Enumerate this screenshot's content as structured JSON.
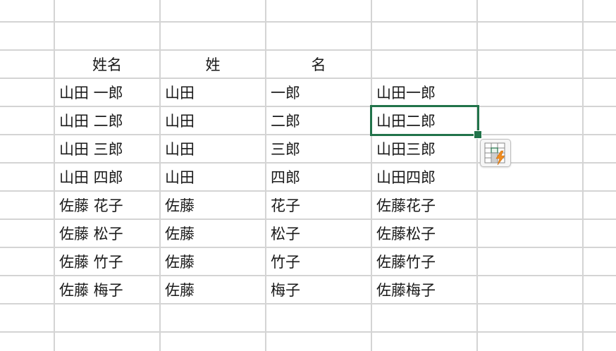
{
  "table": {
    "header": [
      "姓名",
      "姓",
      "名",
      ""
    ],
    "rows": [
      [
        "山田 一郎",
        "山田",
        "一郎",
        "山田一郎"
      ],
      [
        "山田 二郎",
        "山田",
        "二郎",
        "山田二郎"
      ],
      [
        "山田 三郎",
        "山田",
        "三郎",
        "山田三郎"
      ],
      [
        "山田 四郎",
        "山田",
        "四郎",
        "山田四郎"
      ],
      [
        "佐藤 花子",
        "佐藤",
        "花子",
        "佐藤花子"
      ],
      [
        "佐藤 松子",
        "佐藤",
        "松子",
        "佐藤松子"
      ],
      [
        "佐藤 竹子",
        "佐藤",
        "竹子",
        "佐藤竹子"
      ],
      [
        "佐藤 梅子",
        "佐藤",
        "梅子",
        "佐藤梅子"
      ]
    ]
  },
  "selection": {
    "active_value": "山田二郎"
  },
  "colors": {
    "gridline": "#d4d4d4",
    "selection": "#21734a",
    "flash_fill_bolt": "#f08c1e"
  },
  "icons": {
    "flash_fill": "flash-fill-icon"
  }
}
